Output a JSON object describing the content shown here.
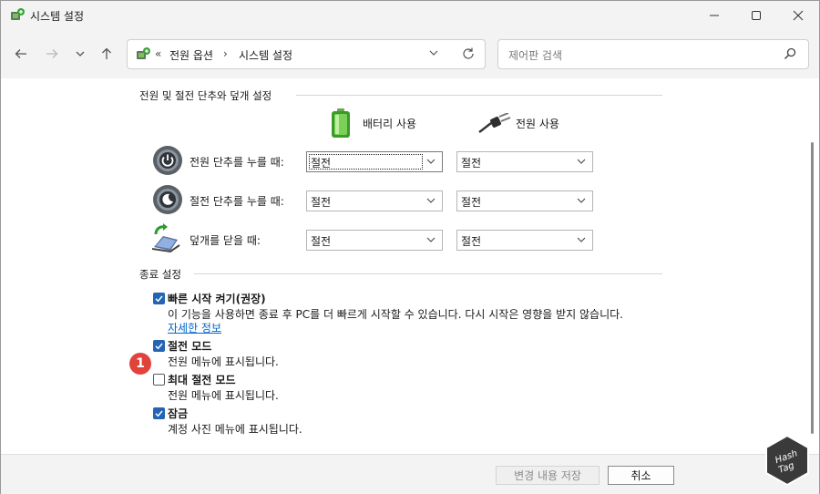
{
  "window": {
    "title": "시스템 설정"
  },
  "address": {
    "prefix": "«",
    "crumbs": [
      "전원 옵션",
      "시스템 설정"
    ],
    "separator": "›"
  },
  "search": {
    "placeholder": "제어판 검색"
  },
  "power_section": {
    "title": "전원 및 절전 단추와 덮개 설정",
    "columns": {
      "battery": "배터리 사용",
      "plugged": "전원 사용"
    },
    "rows": [
      {
        "label": "전원 단추를 누를 때:",
        "battery": "절전",
        "plugged": "절전"
      },
      {
        "label": "절전 단추를 누를 때:",
        "battery": "절전",
        "plugged": "절전"
      },
      {
        "label": "덮개를 닫을 때:",
        "battery": "절전",
        "plugged": "절전"
      }
    ]
  },
  "shutdown_section": {
    "title": "종료 설정",
    "items": [
      {
        "label": "빠른 시작 켜기(권장)",
        "checked": true,
        "desc": "이 기능을 사용하면 종료 후 PC를 더 빠르게 시작할 수 있습니다. 다시 시작은 영향을 받지 않습니다.",
        "link": "자세한 정보"
      },
      {
        "label": "절전 모드",
        "checked": true,
        "desc": "전원 메뉴에 표시됩니다."
      },
      {
        "label": "최대 절전 모드",
        "checked": false,
        "desc": "전원 메뉴에 표시됩니다."
      },
      {
        "label": "잠금",
        "checked": true,
        "desc": "계정 사진 메뉴에 표시됩니다."
      }
    ]
  },
  "annotation": {
    "badge": "1"
  },
  "footer": {
    "save_label": "변경 내용 저장",
    "cancel_label": "취소"
  },
  "watermark": {
    "text_line1": "Hash",
    "text_line2": "Tag"
  },
  "colors": {
    "accent": "#2464b4",
    "link": "#0066cc",
    "badge": "#e0433c"
  }
}
